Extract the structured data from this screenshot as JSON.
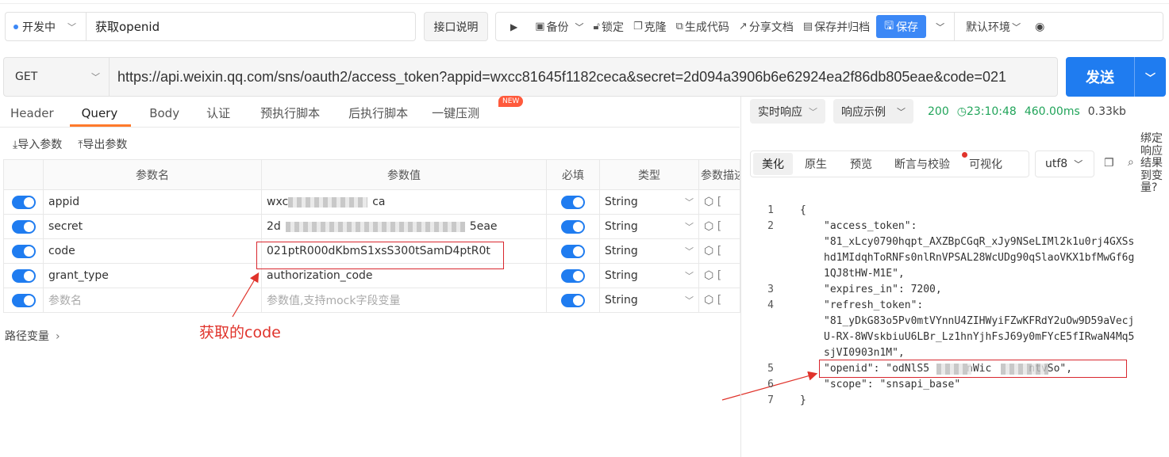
{
  "header": {
    "env": "开发中",
    "title": "获取openid",
    "doc_label": "接口说明",
    "toolbar": {
      "run": "▶",
      "backup": "备份",
      "lock": "锁定",
      "clone": "克隆",
      "gen_code": "生成代码",
      "share": "分享文档",
      "save_archive": "保存并归档",
      "save": "保存",
      "env_default": "默认环境"
    }
  },
  "request": {
    "method": "GET",
    "url": "https://api.weixin.qq.com/sns/oauth2/access_token?appid=wxcc81645f1182ceca&secret=2d094a3906b6e62924ea2f86db805eae&code=021",
    "send": "发送"
  },
  "tabs": [
    "Header",
    "Query",
    "Body",
    "认证",
    "预执行脚本",
    "后执行脚本",
    "一键压测"
  ],
  "new_badge": "NEW",
  "import_label": "导入参数",
  "export_label": "导出参数",
  "columns": [
    "参数名",
    "参数值",
    "必填",
    "类型",
    "参数描述"
  ],
  "params": [
    {
      "name": "appid",
      "value_prefix": "wxc",
      "value_suffix": "ca",
      "type": "String"
    },
    {
      "name": "secret",
      "value_prefix": "2d",
      "value_suffix": "5eae",
      "type": "String"
    },
    {
      "name": "code",
      "value": "021ptR000dKbmS1xsS300tSamD4ptR0t",
      "type": "String"
    },
    {
      "name": "grant_type",
      "value": "authorization_code",
      "type": "String"
    },
    {
      "name": "参数名",
      "value": "参数值,支持mock字段变量",
      "type": "String"
    }
  ],
  "annotation": "获取的code",
  "path_var": "路径变量",
  "response": {
    "mode": "实时响应",
    "example": "响应示例",
    "status": "200",
    "time": "23:10:48",
    "duration": "460.00ms",
    "size": "0.33kb",
    "tabs": [
      "美化",
      "原生",
      "预览",
      "断言与校验",
      "可视化"
    ],
    "encoding": "utf8",
    "bind_text": "绑定响应结果到变量?",
    "lines": [
      {
        "n": "1",
        "t": "{"
      },
      {
        "n": "2",
        "t": "\"access_token\":"
      },
      {
        "n": "",
        "t": "\"81_xLcy0790hqpt_AXZBpCGqR_xJy9NSeLIMl2k1u0rj4GXSs"
      },
      {
        "n": "",
        "t": "hd1MIdqhToRNFs0nlRnVPSAL28WcUDg90qSlaoVKX1bfMwGf6g"
      },
      {
        "n": "",
        "t": "1QJ8tHW-M1E\","
      },
      {
        "n": "3",
        "t": "\"expires_in\": 7200,"
      },
      {
        "n": "4",
        "t": "\"refresh_token\":"
      },
      {
        "n": "",
        "t": "\"81_yDkG83o5Pv0mtVYnnU4ZIHWyiFZwKFRdY2uOw9D59aVecj"
      },
      {
        "n": "",
        "t": "U-RX-8WVskbiuU6LBr_Lz1hnYjhFsJ69y0mFYcE5fIRwaN4Mq5"
      },
      {
        "n": "",
        "t": "sjVI0903n1M\","
      },
      {
        "n": "5",
        "t": "\"openid\": \"odNlS5      nWic      ntvSo\","
      },
      {
        "n": "6",
        "t": "\"scope\": \"snsapi_base\""
      },
      {
        "n": "7",
        "t": "}"
      }
    ]
  }
}
